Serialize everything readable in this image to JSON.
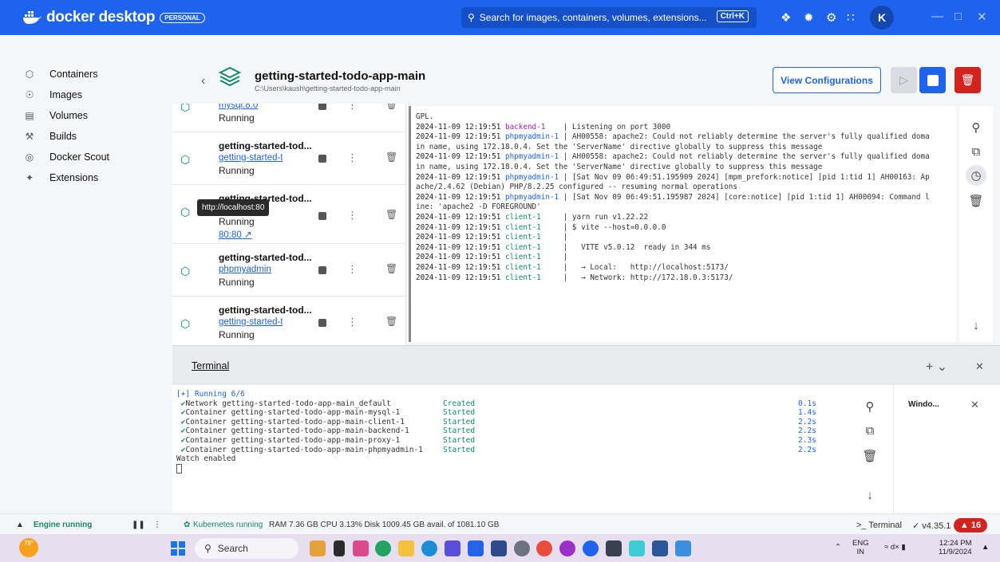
{
  "titlebar": {
    "app_name": "docker desktop",
    "plan_badge": "PERSONAL",
    "search_placeholder": "Search for images, containers, volumes, extensions...",
    "search_shortcut": "Ctrl+K",
    "avatar_initial": "K",
    "brand_color": "#1d63ed"
  },
  "sidebar": {
    "items": [
      {
        "label": "Containers",
        "icon": "container-icon"
      },
      {
        "label": "Images",
        "icon": "image-icon"
      },
      {
        "label": "Volumes",
        "icon": "volume-icon"
      },
      {
        "label": "Builds",
        "icon": "build-icon"
      },
      {
        "label": "Docker Scout",
        "icon": "scout-icon"
      },
      {
        "label": "Extensions",
        "icon": "extension-icon"
      }
    ]
  },
  "header": {
    "project_title": "getting-started-todo-app-main",
    "project_path": "C:\\Users\\kaush\\getting-started-todo-app-main",
    "view_config_label": "View Configurations"
  },
  "containers": [
    {
      "name": "",
      "link": "mysql:8.0",
      "status": "Running"
    },
    {
      "name": "getting-started-tod...",
      "link": "getting-started-todo-app",
      "status": "Running"
    },
    {
      "name": "getting-started-tod...",
      "link": "",
      "status": "Running",
      "port": "80:80"
    },
    {
      "name": "getting-started-tod...",
      "link": "phpmyadmin",
      "status": "Running"
    },
    {
      "name": "getting-started-tod...",
      "link": "getting-started-todo-app",
      "status": "Running"
    }
  ],
  "tooltip": "http://localhost:80",
  "logs": [
    {
      "ts": "",
      "svc": "",
      "msg": "GPL."
    },
    {
      "ts": "2024-11-09 12:19:51",
      "svc": "backend-1",
      "kind": "backend",
      "msg": "    | Listening on port 3000"
    },
    {
      "ts": "2024-11-09 12:19:51",
      "svc": "phpmyadmin-1",
      "kind": "php",
      "msg": " | AH00558: apache2: Could not reliably determine the server's fully qualified doma"
    },
    {
      "ts": "",
      "svc": "",
      "msg": "in name, using 172.18.0.4. Set the 'ServerName' directive globally to suppress this message"
    },
    {
      "ts": "2024-11-09 12:19:51",
      "svc": "phpmyadmin-1",
      "kind": "php",
      "msg": " | AH00558: apache2: Could not reliably determine the server's fully qualified doma"
    },
    {
      "ts": "",
      "svc": "",
      "msg": "in name, using 172.18.0.4. Set the 'ServerName' directive globally to suppress this message"
    },
    {
      "ts": "2024-11-09 12:19:51",
      "svc": "phpmyadmin-1",
      "kind": "php",
      "msg": " | [Sat Nov 09 06:49:51.195909 2024] [mpm_prefork:notice] [pid 1:tid 1] AH00163: Ap"
    },
    {
      "ts": "",
      "svc": "",
      "msg": "ache/2.4.62 (Debian) PHP/8.2.25 configured -- resuming normal operations"
    },
    {
      "ts": "2024-11-09 12:19:51",
      "svc": "phpmyadmin-1",
      "kind": "php",
      "msg": " | [Sat Nov 09 06:49:51.195987 2024] [core:notice] [pid 1:tid 1] AH00094: Command l"
    },
    {
      "ts": "",
      "svc": "",
      "msg": "ine: 'apache2 -D FOREGROUND'"
    },
    {
      "ts": "2024-11-09 12:19:51",
      "svc": "client-1",
      "kind": "client",
      "msg": "     | yarn run v1.22.22"
    },
    {
      "ts": "2024-11-09 12:19:51",
      "svc": "client-1",
      "kind": "client",
      "msg": "     | $ vite --host=0.0.0.0"
    },
    {
      "ts": "2024-11-09 12:19:51",
      "svc": "client-1",
      "kind": "client",
      "msg": "     |"
    },
    {
      "ts": "2024-11-09 12:19:51",
      "svc": "client-1",
      "kind": "client",
      "msg": "     |   VITE v5.0.12  ready in 344 ms"
    },
    {
      "ts": "2024-11-09 12:19:51",
      "svc": "client-1",
      "kind": "client",
      "msg": "     |"
    },
    {
      "ts": "2024-11-09 12:19:51",
      "svc": "client-1",
      "kind": "client",
      "msg": "     |   → Local:   http://localhost:5173/"
    },
    {
      "ts": "2024-11-09 12:19:51",
      "svc": "client-1",
      "kind": "client",
      "msg": "     |   → Network: http://172.18.0.3:5173/"
    }
  ],
  "terminal": {
    "tab_label": "Terminal",
    "header_line": "[+] Running 6/6",
    "lines": [
      {
        "text": "Network getting-started-todo-app-main_default",
        "status": "Created",
        "dur": "0.1s"
      },
      {
        "text": "Container getting-started-todo-app-main-mysql-1",
        "status": "Started",
        "dur": "1.4s"
      },
      {
        "text": "Container getting-started-todo-app-main-client-1",
        "status": "Started",
        "dur": "2.2s"
      },
      {
        "text": "Container getting-started-todo-app-main-backend-1",
        "status": "Started",
        "dur": "2.2s"
      },
      {
        "text": "Container getting-started-todo-app-main-proxy-1",
        "status": "Started",
        "dur": "2.3s"
      },
      {
        "text": "Container getting-started-todo-app-main-phpmyadmin-1",
        "status": "Started",
        "dur": "2.2s"
      }
    ],
    "footer_line": "Watch enabled",
    "side_card_title": "Windo..."
  },
  "statusbar": {
    "engine": "Engine running",
    "kubernetes": "Kubernetes running",
    "resources": "RAM 7.36 GB  CPU 3.13%   Disk 1009.45 GB avail. of 1081.10 GB",
    "terminal_label": "Terminal",
    "version": "v4.35.1",
    "notifications": "16"
  },
  "taskbar": {
    "weather": "78°",
    "search_label": "Search",
    "lang_top": "ENG",
    "lang_bottom": "IN",
    "time": "12:24 PM",
    "date": "11/9/2024"
  }
}
